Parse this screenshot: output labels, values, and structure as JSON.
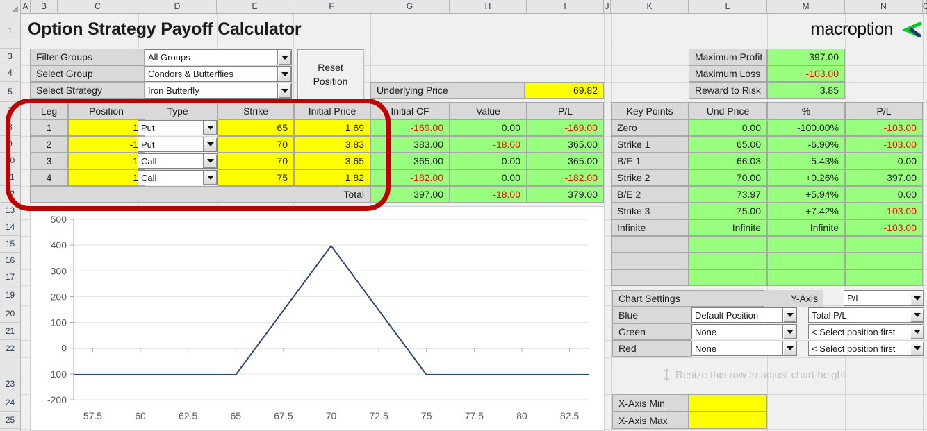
{
  "app": {
    "title": "Option Strategy Payoff Calculator",
    "logo_text": "macroption",
    "logo_green": "#00cc22",
    "logo_navy": "#1f3864"
  },
  "grid": {
    "columns": [
      "A",
      "B",
      "C",
      "D",
      "E",
      "F",
      "G",
      "H",
      "I",
      "J",
      "K",
      "L",
      "M",
      "N",
      "O"
    ],
    "rows": [
      "1",
      "3",
      "4",
      "5",
      "7",
      "8",
      "9",
      "10",
      "11",
      "12",
      "13",
      "14",
      "15",
      "16",
      "17",
      "19",
      "20",
      "21",
      "22",
      "23",
      "24",
      "25"
    ]
  },
  "controls": {
    "filter_groups_label": "Filter Groups",
    "filter_groups_value": "All Groups",
    "select_group_label": "Select Group",
    "select_group_value": "Condors & Butterflies",
    "select_strategy_label": "Select Strategy",
    "select_strategy_value": "Iron Butterfly",
    "reset_line1": "Reset",
    "reset_line2": "Position",
    "underlying_price_label": "Underlying Price",
    "underlying_price_value": "69.82"
  },
  "summary": {
    "rows": [
      {
        "label": "Maximum Profit",
        "value": "397.00",
        "negative": false
      },
      {
        "label": "Maximum Loss",
        "value": "-103.00",
        "negative": true
      },
      {
        "label": "Reward to Risk",
        "value": "3.85",
        "negative": false
      }
    ]
  },
  "legs_table": {
    "headers": [
      "Leg",
      "Position",
      "Type",
      "Strike",
      "Initial Price",
      "Initial CF",
      "Value",
      "P/L"
    ],
    "rows": [
      {
        "leg": "1",
        "position": "1",
        "type": "Put",
        "strike": "65",
        "initial_price": "1.69",
        "initial_cf": "-169.00",
        "initial_cf_neg": true,
        "value": "0.00",
        "value_neg": false,
        "pl": "-169.00",
        "pl_neg": true
      },
      {
        "leg": "2",
        "position": "-1",
        "type": "Put",
        "strike": "70",
        "initial_price": "3.83",
        "initial_cf": "383.00",
        "initial_cf_neg": false,
        "value": "-18.00",
        "value_neg": true,
        "pl": "365.00",
        "pl_neg": false
      },
      {
        "leg": "3",
        "position": "-1",
        "type": "Call",
        "strike": "70",
        "initial_price": "3.65",
        "initial_cf": "365.00",
        "initial_cf_neg": false,
        "value": "0.00",
        "value_neg": false,
        "pl": "365.00",
        "pl_neg": false
      },
      {
        "leg": "4",
        "position": "1",
        "type": "Call",
        "strike": "75",
        "initial_price": "1.82",
        "initial_cf": "-182.00",
        "initial_cf_neg": true,
        "value": "0.00",
        "value_neg": false,
        "pl": "-182.00",
        "pl_neg": true
      }
    ],
    "total_label": "Total",
    "total_initial_cf": "397.00",
    "total_value": "-18.00",
    "total_pl": "379.00"
  },
  "key_points": {
    "headers": [
      "Key Points",
      "Und Price",
      "%",
      "P/L"
    ],
    "rows": [
      {
        "name": "Zero",
        "und_price": "0.00",
        "pct": "-100.00%",
        "pl": "-103.00",
        "pl_neg": true
      },
      {
        "name": "Strike 1",
        "und_price": "65.00",
        "pct": "-6.90%",
        "pl": "-103.00",
        "pl_neg": true
      },
      {
        "name": "B/E 1",
        "und_price": "66.03",
        "pct": "-5.43%",
        "pl": "0.00",
        "pl_neg": false
      },
      {
        "name": "Strike 2",
        "und_price": "70.00",
        "pct": "+0.26%",
        "pl": "397.00",
        "pl_neg": false
      },
      {
        "name": "B/E 2",
        "und_price": "73.97",
        "pct": "+5.94%",
        "pl": "0.00",
        "pl_neg": false
      },
      {
        "name": "Strike 3",
        "und_price": "75.00",
        "pct": "+7.42%",
        "pl": "-103.00",
        "pl_neg": true
      },
      {
        "name": "Infinite",
        "und_price": "Infinite",
        "pct": "Infinite",
        "pl": "-103.00",
        "pl_neg": true
      },
      {
        "name": "",
        "und_price": "",
        "pct": "",
        "pl": "",
        "pl_neg": false
      },
      {
        "name": "",
        "und_price": "",
        "pct": "",
        "pl": "",
        "pl_neg": false
      },
      {
        "name": "",
        "und_price": "",
        "pct": "",
        "pl": "",
        "pl_neg": false
      }
    ]
  },
  "chart_settings": {
    "title": "Chart Settings",
    "yaxis_label": "Y-Axis",
    "yaxis_value": "P/L",
    "series": [
      {
        "color_label": "Blue",
        "position": "Default Position",
        "metric": "Total P/L"
      },
      {
        "color_label": "Green",
        "position": "None",
        "metric": "< Select position first"
      },
      {
        "color_label": "Red",
        "position": "None",
        "metric": "< Select position first"
      }
    ],
    "resize_hint": "Resize this row to adjust chart height",
    "xaxis_min_label": "X-Axis Min",
    "xaxis_min_value": "",
    "xaxis_max_label": "X-Axis Max",
    "xaxis_max_value": ""
  },
  "chart_data": {
    "type": "line",
    "title": "",
    "xlabel": "",
    "ylabel": "",
    "xlim": [
      56.5,
      83.5
    ],
    "ylim": [
      -200,
      500
    ],
    "xticks": [
      "57.5",
      "60",
      "62.5",
      "65",
      "67.5",
      "70",
      "72.5",
      "75",
      "77.5",
      "80",
      "82.5"
    ],
    "xtick_values": [
      57.5,
      60,
      62.5,
      65,
      67.5,
      70,
      72.5,
      75,
      77.5,
      80,
      82.5
    ],
    "yticks": [
      "500",
      "400",
      "300",
      "200",
      "100",
      "0",
      "-100",
      "-200"
    ],
    "ytick_values": [
      500,
      400,
      300,
      200,
      100,
      0,
      -100,
      -200
    ],
    "grid": true,
    "legend": "none",
    "series": [
      {
        "name": "Total P/L",
        "color": "#2e4a72",
        "x": [
          56.5,
          65,
          70,
          75,
          83.5
        ],
        "y": [
          -103,
          -103,
          397,
          -103,
          -103
        ]
      }
    ]
  }
}
